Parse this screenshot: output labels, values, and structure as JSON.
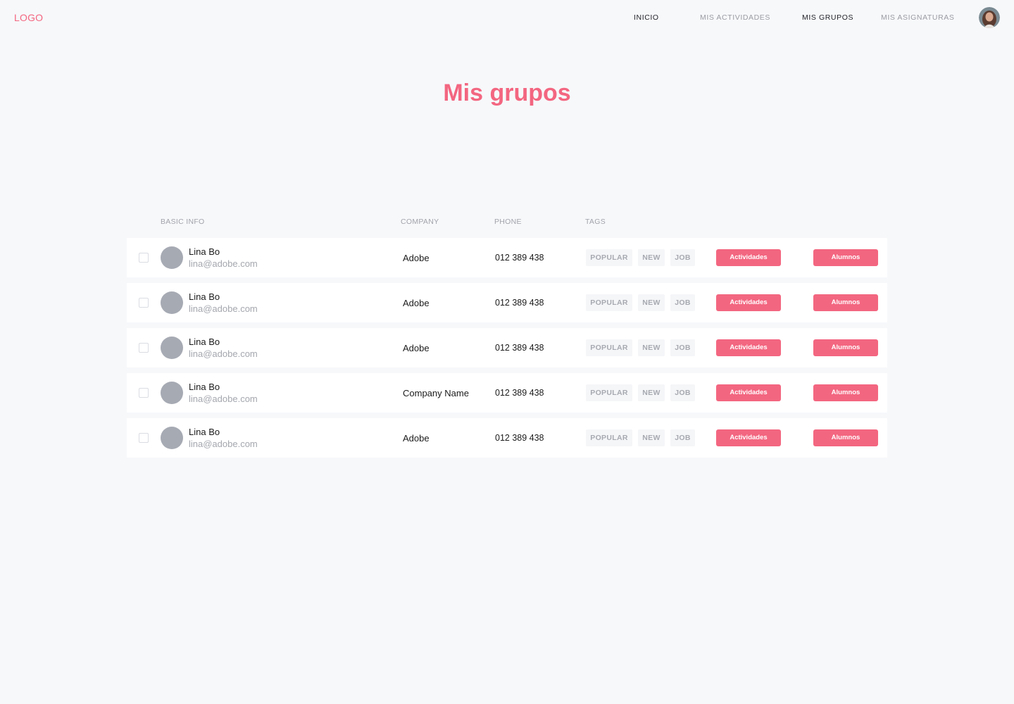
{
  "nav": {
    "logo": "LOGO",
    "links": [
      "INICIO",
      "MIS ACTIVIDADES",
      "MIS GRUPOS",
      "MIS ASIGNATURAS"
    ]
  },
  "page": {
    "title": "Mis grupos"
  },
  "table": {
    "headers": [
      "BASIC INFO",
      "COMPANY",
      "PHONE",
      "TAGS"
    ],
    "rows": [
      {
        "name": "Lina Bo",
        "email": "lina@adobe.com",
        "company": "Adobe",
        "phone": "012 389 438",
        "tags": [
          "POPULAR",
          "NEW",
          "JOB"
        ],
        "btn1": "Actividades",
        "btn2": "Alumnos"
      },
      {
        "name": "Lina Bo",
        "email": "lina@adobe.com",
        "company": "Adobe",
        "phone": "012 389 438",
        "tags": [
          "POPULAR",
          "NEW",
          "JOB"
        ],
        "btn1": "Actividades",
        "btn2": "Alumnos"
      },
      {
        "name": "Lina Bo",
        "email": "lina@adobe.com",
        "company": "Adobe",
        "phone": "012 389 438",
        "tags": [
          "POPULAR",
          "NEW",
          "JOB"
        ],
        "btn1": "Actividades",
        "btn2": "Alumnos"
      },
      {
        "name": "Lina Bo",
        "email": "lina@adobe.com",
        "company": "Company Name",
        "phone": "012 389 438",
        "tags": [
          "POPULAR",
          "NEW",
          "JOB"
        ],
        "btn1": "Actividades",
        "btn2": "Alumnos"
      },
      {
        "name": "Lina Bo",
        "email": "lina@adobe.com",
        "company": "Adobe",
        "phone": "012 389 438",
        "tags": [
          "POPULAR",
          "NEW",
          "JOB"
        ],
        "btn1": "Actividades",
        "btn2": "Alumnos"
      }
    ]
  },
  "colors": {
    "accent": "#f36680",
    "background": "#f7f8fa",
    "muted": "#a4a7ae"
  }
}
